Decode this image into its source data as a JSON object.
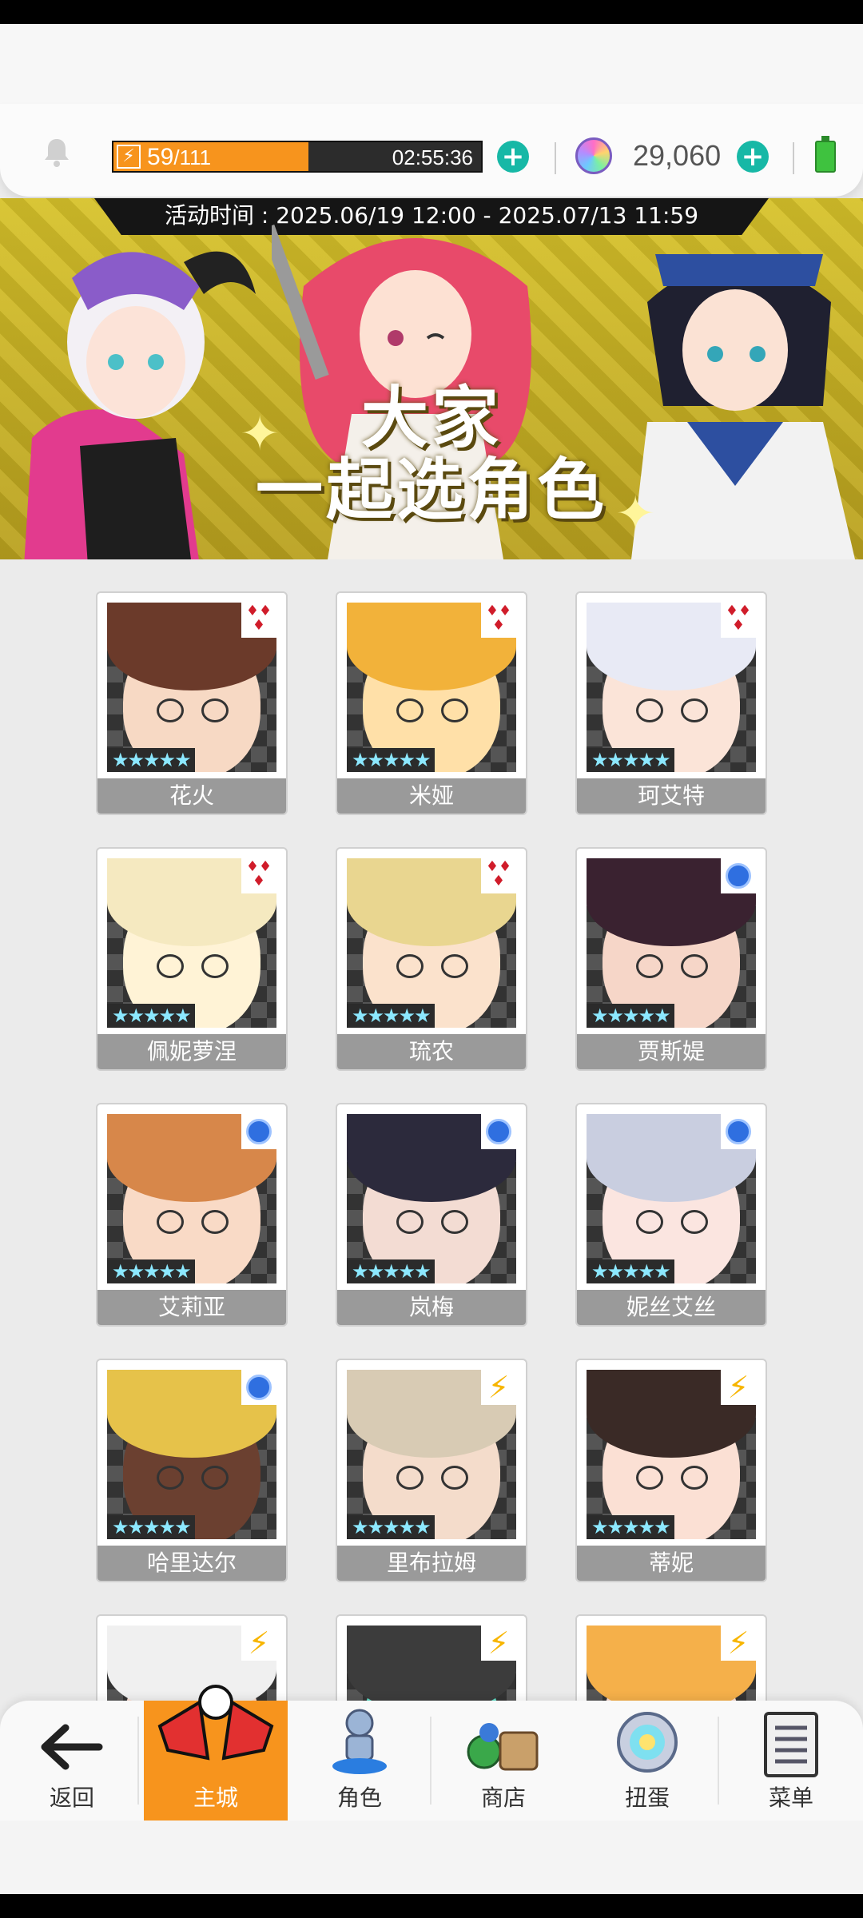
{
  "resources": {
    "energy_current": "59",
    "energy_max": "/111",
    "energy_fraction": 0.53,
    "energy_timer": "02:55:36",
    "gem_count": "29,060"
  },
  "banner": {
    "event_time": "活动时间 : 2025.06/19 12:00 - 2025.07/13 11:59",
    "title": "大家\n一起选角色"
  },
  "characters": [
    {
      "name": "花火",
      "stars": "★★★★★",
      "badge": "red",
      "hair": "#6b3a2a",
      "skin": "#f7d9c4"
    },
    {
      "name": "米娅",
      "stars": "★★★★★",
      "badge": "red",
      "hair": "#f2b23a",
      "skin": "#ffe0a8"
    },
    {
      "name": "珂艾特",
      "stars": "★★★★★",
      "badge": "red",
      "hair": "#e8eaf5",
      "skin": "#fbe4d8"
    },
    {
      "name": "佩妮萝涅",
      "stars": "★★★★★",
      "badge": "red",
      "hair": "#f5e9c0",
      "skin": "#fff3d6"
    },
    {
      "name": "琉农",
      "stars": "★★★★★",
      "badge": "red",
      "hair": "#e9d690",
      "skin": "#fbe2cc"
    },
    {
      "name": "贾斯媞",
      "stars": "★★★★★",
      "badge": "blue",
      "hair": "#3a2230",
      "skin": "#f6d6c8"
    },
    {
      "name": "艾莉亚",
      "stars": "★★★★★",
      "badge": "blue",
      "hair": "#d7874a",
      "skin": "#f9dac6"
    },
    {
      "name": "岚梅",
      "stars": "★★★★★",
      "badge": "blue",
      "hair": "#2c2a3c",
      "skin": "#f3dcd3"
    },
    {
      "name": "妮丝艾丝",
      "stars": "★★★★★",
      "badge": "blue",
      "hair": "#c9cee0",
      "skin": "#fbe5e0"
    },
    {
      "name": "哈里达尔",
      "stars": "★★★★★",
      "badge": "blue",
      "hair": "#e6c24a",
      "skin": "#6b4030"
    },
    {
      "name": "里布拉姆",
      "stars": "★★★★★",
      "badge": "bolt",
      "hair": "#d8cbb4",
      "skin": "#f4dccb"
    },
    {
      "name": "蒂妮",
      "stars": "★★★★★",
      "badge": "bolt",
      "hair": "#3a2a26",
      "skin": "#fbe0d4"
    },
    {
      "name": "",
      "stars": "",
      "badge": "bolt",
      "hair": "#f0f0f0",
      "skin": "#fbe0d4"
    },
    {
      "name": "",
      "stars": "",
      "badge": "bolt",
      "hair": "#3c3c3c",
      "skin": "#5fe0c8"
    },
    {
      "name": "",
      "stars": "",
      "badge": "bolt",
      "hair": "#f5b04a",
      "skin": "#fbe0d4"
    }
  ],
  "nav": [
    {
      "label": "返回",
      "icon": "back-arrow-icon"
    },
    {
      "label": "主城",
      "icon": "main-city-icon"
    },
    {
      "label": "角色",
      "icon": "character-icon"
    },
    {
      "label": "商店",
      "icon": "shop-icon"
    },
    {
      "label": "扭蛋",
      "icon": "gacha-icon"
    },
    {
      "label": "菜单",
      "icon": "menu-icon"
    }
  ],
  "colors": {
    "accent_orange": "#f7941d",
    "plus_teal": "#17b8a6",
    "rarity_red": "#d01c2a",
    "rarity_blue": "#2f6fe0",
    "rarity_bolt": "#f7b500"
  }
}
